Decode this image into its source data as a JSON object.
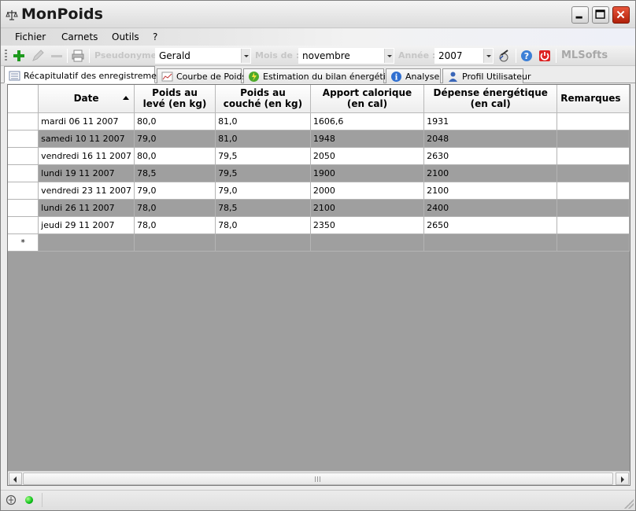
{
  "window": {
    "title": "MonPoids"
  },
  "menu": [
    "Fichier",
    "Carnets",
    "Outils",
    "?"
  ],
  "toolbar": {
    "pseudonyme_label": "Pseudonyme :",
    "pseudonyme_value": "Gerald",
    "mois_label": "Mois de :",
    "mois_value": "novembre",
    "annee_label": "Année :",
    "annee_value": "2007",
    "brand": "MLSofts",
    "icons": [
      "add-icon",
      "edit-icon",
      "delete-icon",
      "print-icon",
      "tools-icon",
      "help-icon",
      "exit-icon"
    ]
  },
  "tabs": [
    {
      "label": "Récapitulatif des enregistrements",
      "icon": "list-icon",
      "active": true
    },
    {
      "label": "Courbe de Poids",
      "icon": "chart-icon",
      "active": false
    },
    {
      "label": "Estimation du bilan énergétique",
      "icon": "energy-icon",
      "active": false
    },
    {
      "label": "Analyse",
      "icon": "info-icon",
      "active": false
    },
    {
      "label": "Profil Utilisateur",
      "icon": "user-icon",
      "active": false
    }
  ],
  "grid": {
    "columns": [
      {
        "line1": "Date",
        "line2": ""
      },
      {
        "line1": "Poids au",
        "line2": "levé (en kg)"
      },
      {
        "line1": "Poids au",
        "line2": "couché (en kg)"
      },
      {
        "line1": "Apport calorique",
        "line2": "(en cal)"
      },
      {
        "line1": "Dépense énergétique",
        "line2": "(en cal)"
      },
      {
        "line1": "Remarques",
        "line2": ""
      }
    ],
    "rows": [
      [
        "mardi 06 11 2007",
        "80,0",
        "81,0",
        "1606,6",
        "1931",
        ""
      ],
      [
        "samedi 10 11 2007",
        "79,0",
        "81,0",
        "1948",
        "2048",
        ""
      ],
      [
        "vendredi 16 11 2007",
        "80,0",
        "79,5",
        "2050",
        "2630",
        ""
      ],
      [
        "lundi 19 11 2007",
        "78,5",
        "79,5",
        "1900",
        "2100",
        ""
      ],
      [
        "vendredi 23 11 2007",
        "79,0",
        "79,0",
        "2000",
        "2100",
        ""
      ],
      [
        "lundi 26 11 2007",
        "78,0",
        "78,5",
        "2100",
        "2400",
        ""
      ],
      [
        "jeudi 29 11 2007",
        "78,0",
        "78,0",
        "2350",
        "2650",
        ""
      ]
    ],
    "new_row_marker": "*",
    "sort_column": "Date",
    "sort_direction": "asc"
  },
  "colors": {
    "grid_background": "#9f9f9f",
    "row_white": "#ffffff",
    "row_gray": "#9f9f9f",
    "status_led": "#0bbf18",
    "close_button": "#c8371c"
  }
}
